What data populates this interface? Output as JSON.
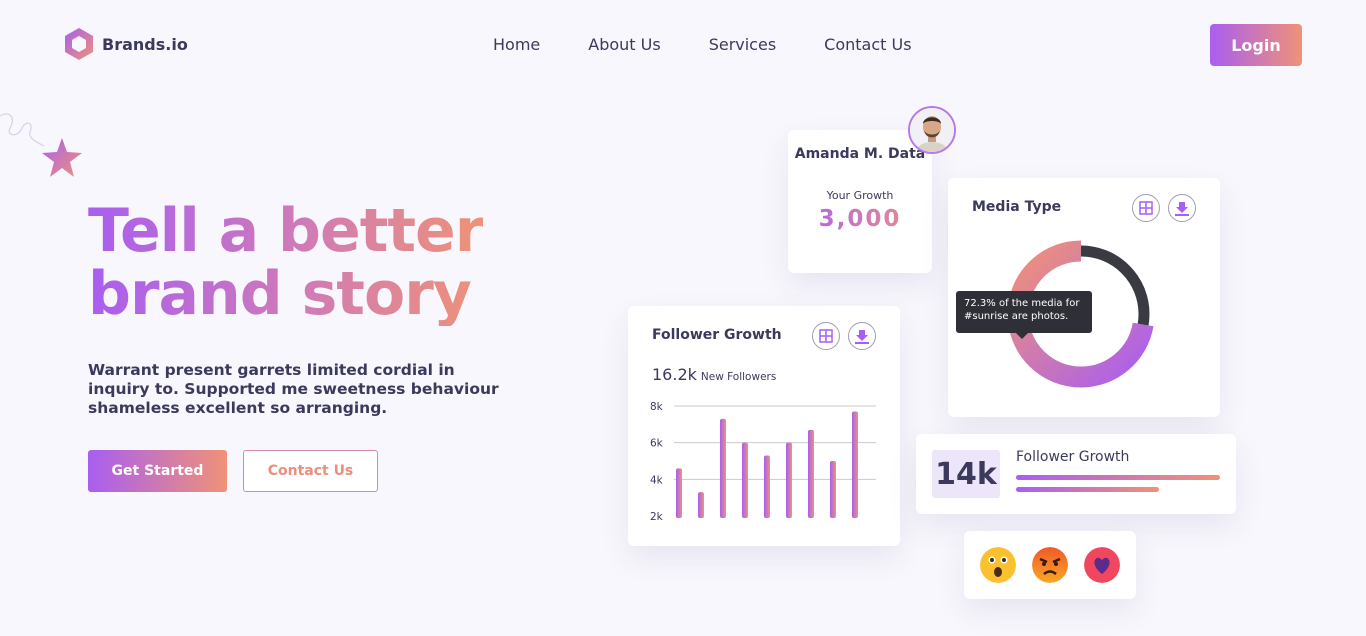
{
  "brand": {
    "name": "Brands.io"
  },
  "nav": {
    "items": [
      {
        "label": "Home"
      },
      {
        "label": "About Us"
      },
      {
        "label": "Services"
      },
      {
        "label": "Contact Us"
      }
    ],
    "login_label": "Login"
  },
  "hero": {
    "title_line1": "Tell a better",
    "title_line2": "brand story",
    "description": "Warrant present garrets limited cordial in inquiry to. Supported me sweetness behaviour shameless excellent so arranging.",
    "primary_button": "Get Started",
    "secondary_button": "Contact Us"
  },
  "profile_card": {
    "name": "Amanda M. Data",
    "metric_label": "Your Growth",
    "metric_value": "3,000"
  },
  "media_card": {
    "title": "Media Type",
    "tooltip": "72.3% of the media for #sunrise are photos."
  },
  "follower_card": {
    "title": "Follower Growth",
    "count": "16.2k",
    "count_label": "New Followers"
  },
  "growth_card": {
    "value": "14k",
    "label": "Follower Growth",
    "bar_levels": [
      1.0,
      0.7
    ]
  },
  "icons": [
    "grid-icon",
    "download-icon",
    "star-icon",
    "hexagon-logo-icon",
    "surprised-emoji-icon",
    "angry-emoji-icon",
    "heart-emoji-icon"
  ],
  "colors": {
    "gradient_start": "#a95ef0",
    "gradient_end": "#ef9277",
    "text_dark": "#3b3a5c",
    "donut_dark": "#3a3a42"
  },
  "chart_data": [
    {
      "type": "pie",
      "title": "Media Type",
      "values": [
        72.3,
        27.7
      ],
      "labels": [
        "photos",
        ""
      ]
    },
    {
      "type": "bar",
      "title": "Follower Growth",
      "yticks": [
        "8k",
        "6k",
        "4k",
        "2k"
      ],
      "ylim": [
        2000,
        8000
      ],
      "grid": true,
      "values": [
        4600,
        3300,
        7300,
        6000,
        5300,
        6000,
        6700,
        5000,
        7700
      ]
    }
  ]
}
